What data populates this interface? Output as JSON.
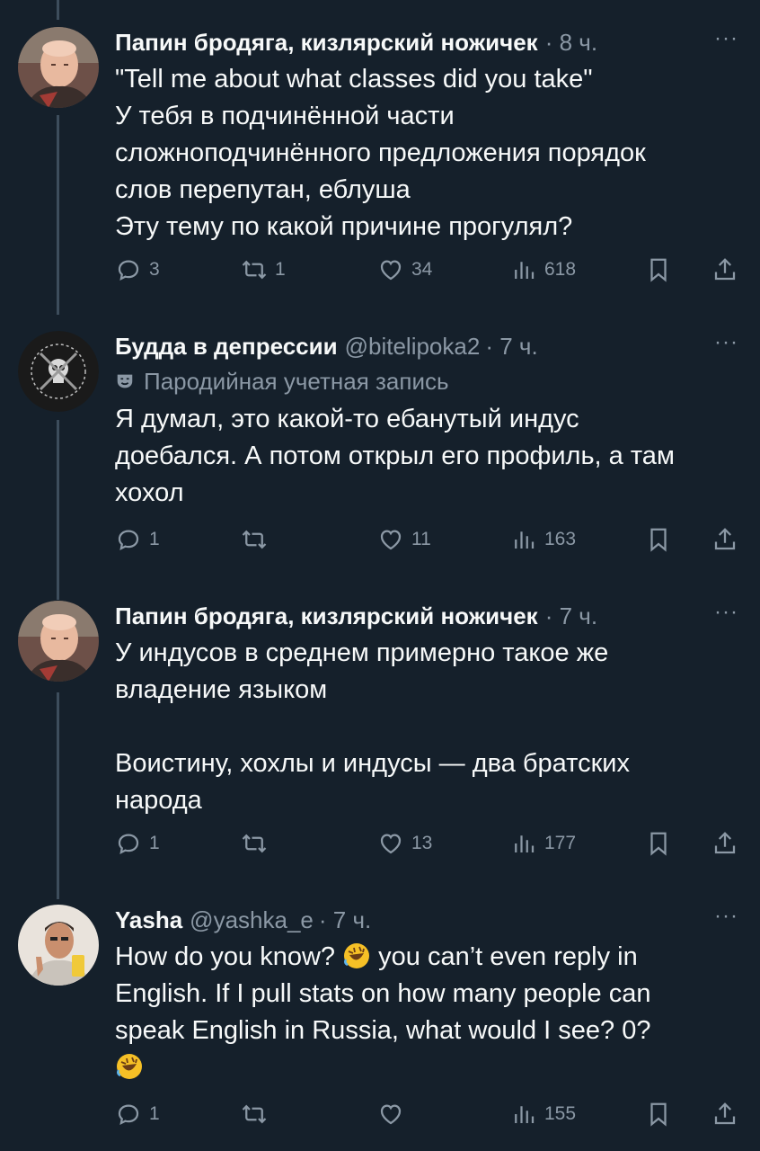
{
  "tweets": [
    {
      "name": "Папин бродяга, кизлярский ножичек",
      "handle": "",
      "time": "· 8 ч.",
      "text": "\"Tell me about what classes did you take\"\nУ тебя в подчинённой части\nсложноподчинённого предложения порядок\nслов перепутан, еблуша\nЭту тему по какой причине прогулял?",
      "replies": "3",
      "retweets": "1",
      "likes": "34",
      "views": "618"
    },
    {
      "name": "Будда в депрессии",
      "handle": "@bitelipoka2",
      "time": "· 7 ч.",
      "badge": "Пародийная учетная запись",
      "text": "Я думал, это какой-то ебанутый индус\nдоебался. А потом открыл его профиль, а там\nхохол",
      "replies": "1",
      "retweets": "",
      "likes": "11",
      "views": "163"
    },
    {
      "name": "Папин бродяга, кизлярский ножичек",
      "handle": "",
      "time": "· 7 ч.",
      "text": "У индусов в среднем примерно такое же\nвладение языком\n\nВоистину, хохлы и индусы — два братских\nнарода",
      "replies": "1",
      "retweets": "",
      "likes": "13",
      "views": "177"
    },
    {
      "name": "Yasha",
      "handle": "@yashka_e",
      "time": "· 7 ч.",
      "text_a": "How do you know? ",
      "text_b": " you can’t even reply in\nEnglish. If I pull stats on how many people can\nspeak English in Russia, what would I see? 0?\n",
      "replies": "1",
      "retweets": "",
      "likes": "",
      "views": "155"
    }
  ],
  "more_label": "···",
  "icons": [
    "reply-icon",
    "retweet-icon",
    "like-icon",
    "views-icon",
    "bookmark-icon",
    "share-icon",
    "rofl-emoji"
  ]
}
